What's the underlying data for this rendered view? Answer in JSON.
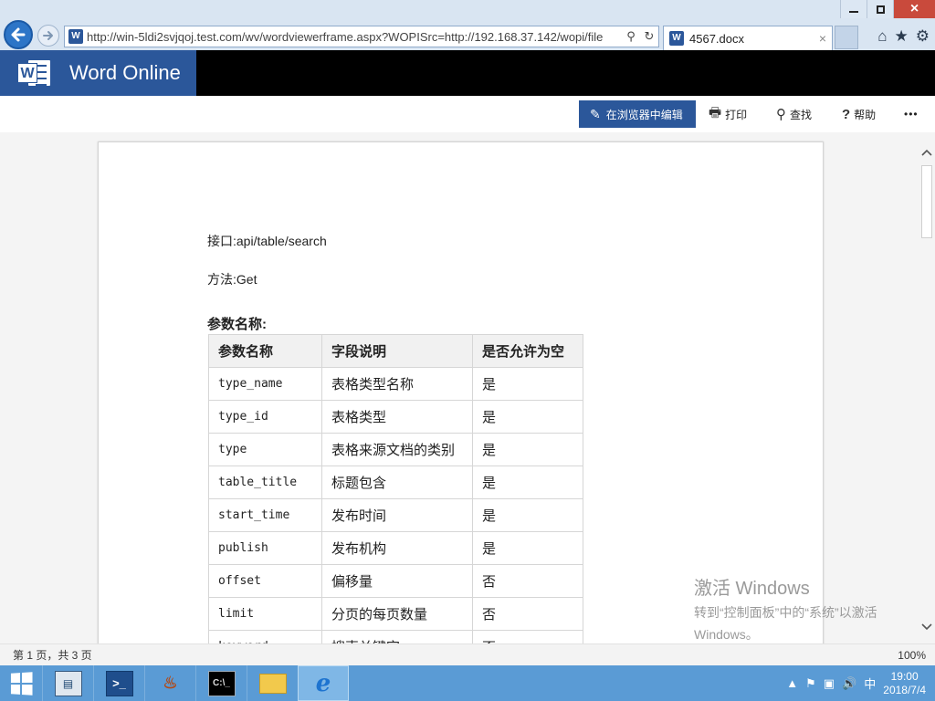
{
  "browser": {
    "address_url": "http://win-5ldi2svjqoj.test.com/wv/wordviewerframe.aspx?WOPISrc=http://192.168.37.142/wopi/file",
    "address_actions": [
      "⚲",
      "↻"
    ],
    "tab_title": "4567.docx",
    "tab_close": "×",
    "favicon_letter": "W",
    "tools": [
      "⌂",
      "★",
      "⚙"
    ],
    "window_controls": {
      "minimize": "",
      "maximize": "",
      "close": "×"
    }
  },
  "app": {
    "name": "Word Online",
    "logo_letter": "W",
    "brand_color": "#2b579a"
  },
  "toolbar": {
    "edit_in_browser": "在浏览器中编辑",
    "edit_icon": "✎",
    "print": "打印",
    "print_icon": "🖶",
    "find": "查找",
    "find_icon": "⚲",
    "help": "帮助",
    "help_icon": "?",
    "more": "•••"
  },
  "document": {
    "interface_line": "接口:api/table/search",
    "method_line": "方法:Get",
    "params_heading": "参数名称:",
    "table": {
      "headers": [
        "参数名称",
        "字段说明",
        "是否允许为空"
      ],
      "rows": [
        [
          "type_name",
          "表格类型名称",
          "是"
        ],
        [
          "type_id",
          "表格类型",
          "是"
        ],
        [
          "type",
          "表格来源文档的类别",
          "是"
        ],
        [
          "table_title",
          "标题包含",
          "是"
        ],
        [
          "start_time",
          "发布时间",
          "是"
        ],
        [
          "publish",
          "发布机构",
          "是"
        ],
        [
          "offset",
          "偏移量",
          "否"
        ],
        [
          "limit",
          "分页的每页数量",
          "否"
        ],
        [
          "keyword",
          "搜索关键字",
          "否"
        ]
      ]
    }
  },
  "watermark": {
    "line1": "激活 Windows",
    "line2": "转到“控制面板”中的“系统”以激活",
    "line3": "Windows。"
  },
  "statusbar": {
    "page_info": "第 1 页，共 3 页",
    "zoom": "100%"
  },
  "taskbar": {
    "apps": [
      "server-manager",
      "powershell",
      "java",
      "command-prompt",
      "file-explorer",
      "internet-explorer"
    ],
    "tray_icons": [
      "▲",
      "⚑",
      "▣",
      "🔊"
    ],
    "ime": "中",
    "time": "19:00",
    "date": "2018/7/4"
  }
}
